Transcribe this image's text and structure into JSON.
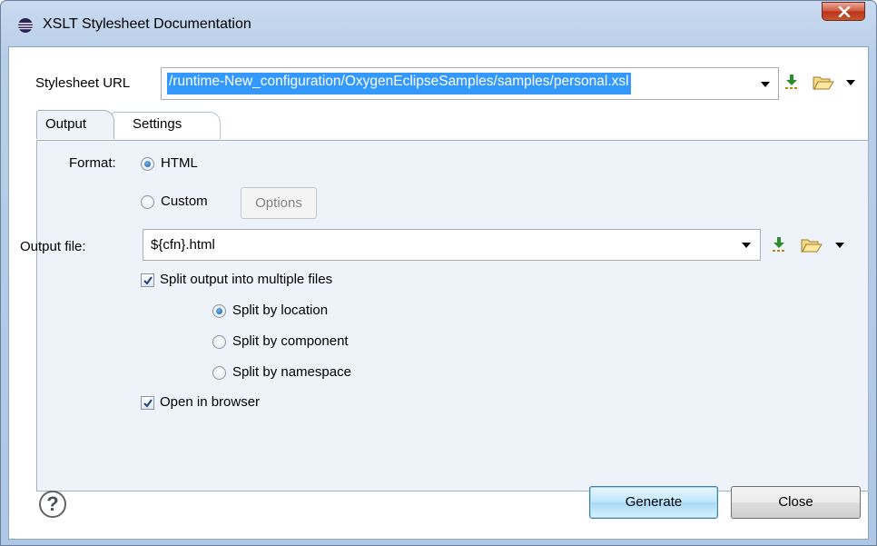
{
  "window": {
    "title": "XSLT Stylesheet Documentation"
  },
  "stylesheet": {
    "label": "Stylesheet URL",
    "value": "/runtime-New_configuration/OxygenEclipseSamples/samples/personal.xsl"
  },
  "tabs": [
    {
      "label": "Output",
      "selected": true
    },
    {
      "label": "Settings",
      "selected": false
    }
  ],
  "format": {
    "label": "Format:",
    "options": [
      {
        "label": "HTML",
        "checked": true
      },
      {
        "label": "Custom",
        "checked": false
      }
    ],
    "options_button": "Options"
  },
  "output_file": {
    "label": "Output file:",
    "value": "${cfn}.html"
  },
  "split_output": {
    "label": "Split output into multiple files",
    "checked": true,
    "options": [
      {
        "label": "Split by location",
        "checked": true
      },
      {
        "label": "Split by component",
        "checked": false
      },
      {
        "label": "Split by namespace",
        "checked": false
      }
    ]
  },
  "open_in_browser": {
    "label": "Open in browser",
    "checked": true
  },
  "buttons": {
    "generate": "Generate",
    "close": "Close",
    "help": "?"
  },
  "icons": {
    "title": "eclipse-icon",
    "insert": "insert-editor-variables-icon",
    "browse": "folder-open-icon",
    "close": "close-icon"
  },
  "colors": {
    "selection": "#3399ff",
    "panel": "#eef3fa",
    "close_button": "#c9552f"
  }
}
